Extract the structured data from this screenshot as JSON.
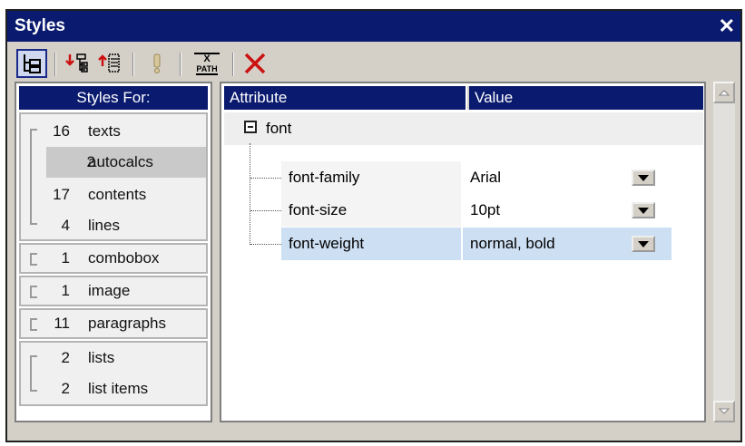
{
  "window": {
    "title": "Styles"
  },
  "toolbar": {
    "items": [
      "tree-view",
      "append-style",
      "insert-style",
      "warning",
      "xpath",
      "delete"
    ],
    "xpath_top": "X",
    "xpath_bottom": "PATH"
  },
  "left": {
    "header": "Styles For:",
    "groups": [
      {
        "items": [
          {
            "count": "16",
            "name": "texts"
          },
          {
            "count": "2",
            "name": "autocalcs",
            "selected": true
          },
          {
            "count": "17",
            "name": "contents"
          },
          {
            "count": "4",
            "name": "lines"
          }
        ]
      },
      {
        "items": [
          {
            "count": "1",
            "name": "combobox"
          }
        ]
      },
      {
        "items": [
          {
            "count": "1",
            "name": "image"
          }
        ]
      },
      {
        "items": [
          {
            "count": "11",
            "name": "paragraphs"
          }
        ]
      },
      {
        "items": [
          {
            "count": "2",
            "name": "lists"
          },
          {
            "count": "2",
            "name": "list items"
          }
        ]
      }
    ]
  },
  "right": {
    "col_attribute": "Attribute",
    "col_value": "Value",
    "group_label": "font",
    "rows": [
      {
        "attribute": "font-family",
        "value": "Arial"
      },
      {
        "attribute": "font-size",
        "value": "10pt"
      },
      {
        "attribute": "font-weight",
        "value": "normal, bold",
        "selected": true
      }
    ]
  },
  "colors": {
    "titlebar": "#0a1a6e",
    "selected_row": "#cddff2",
    "delete_red": "#cc1111"
  }
}
